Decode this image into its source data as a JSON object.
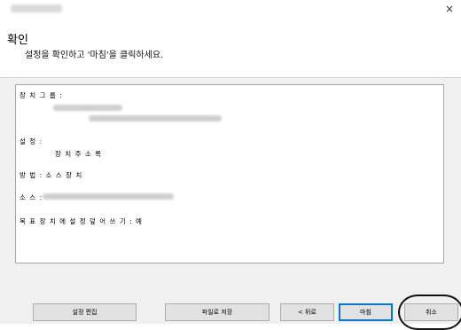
{
  "window": {
    "close_glyph": "×"
  },
  "header": {
    "title": "확인",
    "subtitle": "설정을 확인하고 '마침'을 클릭하세요."
  },
  "summary": {
    "device_name_label": "장 치 그 룹 :",
    "settings_label": "설 정 :",
    "settings_value": "장 치 주 소 록",
    "method_label": "방 법 : 소 스 장 치",
    "source_label": "소 스 :",
    "overwrite_label": "목 표 장 치 에 설 정 덮 어 쓰 기 : 예"
  },
  "buttons": {
    "edit_settings": "설정 편집",
    "save_file": "파일로 저장",
    "back": "< 뒤로",
    "finish": "마침",
    "cancel": "취소"
  }
}
